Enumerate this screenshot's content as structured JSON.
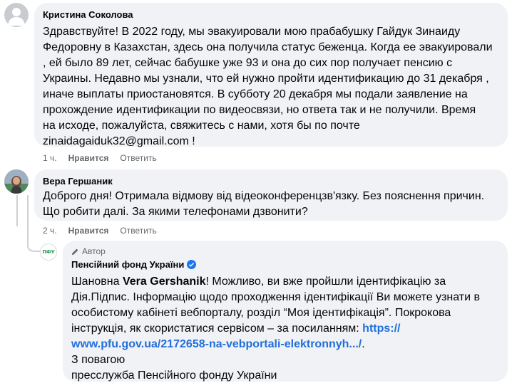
{
  "comments": [
    {
      "author": "Кристина Соколова",
      "lines": [
        "Здравствуйте! В 2022 году, мы эвакуировали мою прабабушку Гайдук Зинаиду",
        "Федоровну в Казахстан, здесь она получила статус беженца. Когда ее эвакуировали",
        ", ей было 89 лет, сейчас бабушке уже 93 и она до сих пор получает пенсию с",
        "Украины. Недавно мы узнали, что ей нужно пройти идентификацию до 31 декабря ,",
        "иначе выплаты приостановятся. В субботу 20 декабря мы подали заявление на",
        "прохождение идентификации по видеосвязи, но ответа так и не получили. Время",
        "на исходе, пожалуйста, свяжитесь с нами, хотя бы по почте",
        "zinaidagaiduk32@gmail.com !"
      ],
      "time": "1 ч.",
      "like": "Нравится",
      "reply": "Ответить"
    },
    {
      "author": "Вера Гершаник",
      "lines": [
        "Доброго дня! Отримала відмову від відеоконференцзв'язку. Без пояснення причин.",
        "Що робити далі. За якими телефонами дзвонити?"
      ],
      "time": "2 ч.",
      "like": "Нравится",
      "reply": "Ответить"
    }
  ],
  "reply": {
    "badge": "Автор",
    "author": "Пенсійний фонд України",
    "avatar_text": "ПФУ",
    "line1_pre": "Шановна ",
    "line1_name": "Vera Gershanik",
    "line1_post": "! Можливо, ви вже пройшли ідентифікацію за",
    "line2": "Дія.Підпис. Інформацію щодо проходження ідентифікації Ви можете узнати в",
    "line3": "особистому кабінеті вебпорталу, розділ “Моя ідентифікація”. Покрокова",
    "line4_pre": "інструкція, як скористатися сервісом – за посиланням: ",
    "line4_link": "https://",
    "line5_link": "www.pfu.gov.ua/2172658-na-vebportali-elektronnyh.../",
    "line5_post": ".",
    "line6": "З повагою",
    "line7": "пресслужба Пенсійного фонду України"
  },
  "colors": {
    "bubble": "#f0f2f5",
    "link": "#216fdb",
    "verified": "#1877f2",
    "meta": "#65676b"
  }
}
